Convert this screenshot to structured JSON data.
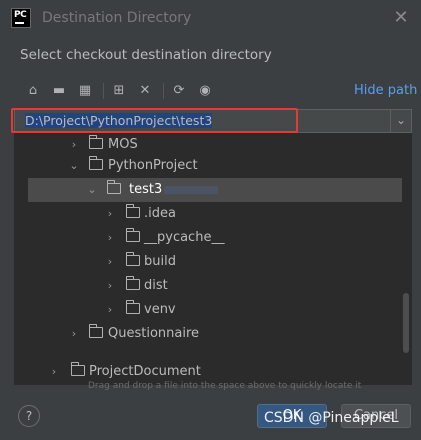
{
  "window": {
    "title": "Destination Directory",
    "logo_text": "PC"
  },
  "subtitle": "Select checkout destination directory",
  "toolbar": {
    "icons": [
      "home-icon",
      "desktop-icon",
      "project-folder-icon",
      "new-folder-icon",
      "delete-icon",
      "refresh-icon",
      "show-hidden-icon"
    ],
    "hide_path_label": "Hide path"
  },
  "path": {
    "value": "D:\\Project\\PythonProject\\test3"
  },
  "tree": {
    "items": [
      {
        "label": "MOS",
        "expanded": false
      },
      {
        "label": "PythonProject",
        "expanded": true
      },
      {
        "label": "test3",
        "expanded": true,
        "selected": true
      },
      {
        "label": ".idea",
        "expanded": false
      },
      {
        "label": "__pycache__",
        "expanded": false
      },
      {
        "label": "build",
        "expanded": false
      },
      {
        "label": "dist",
        "expanded": false
      },
      {
        "label": "venv",
        "expanded": false
      },
      {
        "label": "Questionnaire",
        "expanded": false
      }
    ],
    "root_item": {
      "label": "ProjectDocument",
      "expanded": false
    }
  },
  "hint": "Drag and drop a file into the space above to quickly locate it",
  "buttons": {
    "help": "?",
    "ok": "OK",
    "cancel": "Cancel"
  },
  "watermark": "CSDN @PineappleL",
  "colors": {
    "accent": "#589df6",
    "highlight": "#e53935",
    "ok_button": "#365880"
  }
}
